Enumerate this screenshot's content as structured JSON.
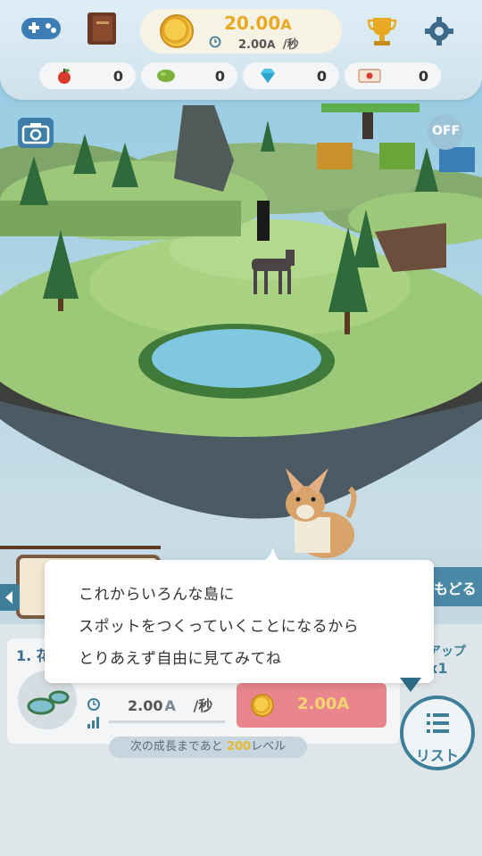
{
  "currency": {
    "amount": "20.00",
    "amount_unit": "A",
    "rate": "2.00",
    "rate_unit": "A",
    "rate_suffix": "/秒"
  },
  "resources": [
    {
      "icon": "apple-icon",
      "value": "0"
    },
    {
      "icon": "bean-icon",
      "value": "0"
    },
    {
      "icon": "diamond-icon",
      "value": "0"
    },
    {
      "icon": "ticket-icon",
      "value": "0"
    }
  ],
  "scene": {
    "off_badge": "OFF"
  },
  "dialog": {
    "lines": [
      "これからいろんな島に",
      "スポットをつくっていくことになるから",
      "とりあえず自由に見てみてね"
    ]
  },
  "panel": {
    "item_title_partial": "1. 花",
    "side_back_label": "もどる",
    "side_upgrade_label": "アップ",
    "side_upgrade_mult": "x1",
    "rate_value": "2.00",
    "rate_unit": "A",
    "rate_suffix": "/秒",
    "buy_value": "2.00",
    "buy_unit": "A",
    "growth_prefix": "次の成長まであと",
    "growth_level": "200",
    "growth_suffix": "レベル",
    "list_label": "リスト"
  },
  "colors": {
    "accent": "#3e7e98",
    "gold": "#e8a925",
    "buy": "#e9858d"
  }
}
